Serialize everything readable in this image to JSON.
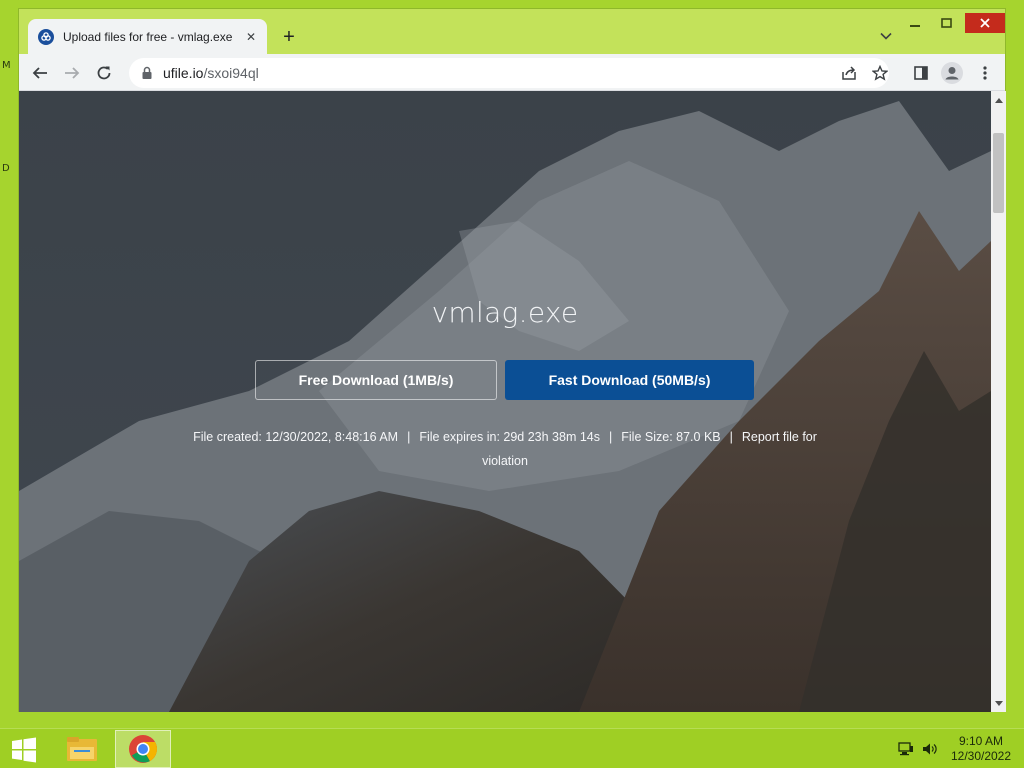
{
  "desktop": {
    "icon_fragments": [
      "M",
      "D"
    ]
  },
  "browser": {
    "tab": {
      "title": "Upload files for free - vmlag.exe",
      "close_glyph": "✕",
      "favicon": "ufile-logo-icon"
    },
    "new_tab_glyph": "+",
    "address_bar": {
      "host": "ufile.io",
      "path": "/sxoi94ql"
    },
    "toolbar_icons": [
      "back-arrow-icon",
      "forward-arrow-icon",
      "reload-icon",
      "lock-icon",
      "share-icon",
      "star-icon",
      "side-panel-icon",
      "profile-icon",
      "menu-dots-icon"
    ],
    "window_controls": [
      "minimize-icon",
      "maximize-icon",
      "close-icon"
    ],
    "accent_colors": {
      "fast_download": "#0b4f95",
      "window_close": "#c42b1c"
    }
  },
  "page": {
    "file_name": "vmlag.exe",
    "free_download_label": "Free Download (1MB/s)",
    "fast_download_label": "Fast Download (50MB/s)",
    "file_created": "File created: 12/30/2022, 8:48:16 AM",
    "file_expires": "File expires in: 29d 23h 38m 14s",
    "file_size": "File Size: 87.0 KB",
    "report_link": "Report file for violation",
    "separator": "|"
  },
  "taskbar": {
    "pinned": [
      "windows-start-icon",
      "file-explorer-icon",
      "chrome-icon"
    ],
    "time": "9:10 AM",
    "date": "12/30/2022"
  }
}
